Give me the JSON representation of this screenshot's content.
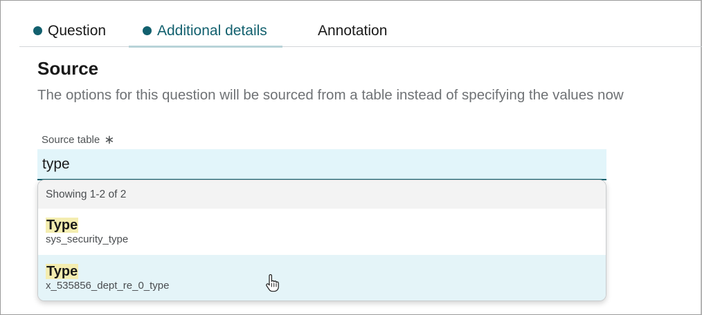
{
  "tabs": [
    {
      "label": "Question",
      "has_dot": true,
      "active": false
    },
    {
      "label": "Additional details",
      "has_dot": true,
      "active": true
    },
    {
      "label": "Annotation",
      "has_dot": false,
      "active": false
    }
  ],
  "source": {
    "title": "Source",
    "description": "The options for this question will be sourced from a table instead of specifying the values now",
    "field_label": "Source table",
    "required_marker": "∗",
    "input_value": "type"
  },
  "dropdown": {
    "count_text": "Showing 1-2 of 2",
    "options": [
      {
        "title": "Type",
        "subtitle": "sys_security_type"
      },
      {
        "title": "Type",
        "subtitle": "x_535856_dept_re_0_type"
      }
    ],
    "hovered_index": 1
  },
  "colors": {
    "accent": "#12606e",
    "input_bg": "#e2f5fa",
    "highlight": "#f4edb0",
    "hover_row": "#e4f4f8"
  },
  "icons": {
    "tab_status": "dot-icon",
    "cursor": "hand-pointer-icon"
  }
}
